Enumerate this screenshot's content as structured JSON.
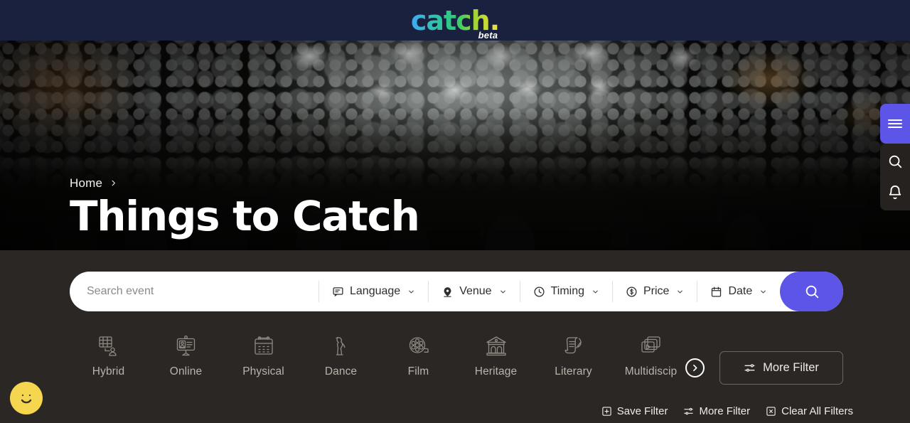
{
  "header": {
    "logo_text": "catch.",
    "logo_badge": "beta",
    "logo_gradient_from": "#3fa9f5",
    "logo_gradient_to": "#f2e33a",
    "bg": "#19213f"
  },
  "hero": {
    "breadcrumb": [
      {
        "label": "Home",
        "name": "breadcrumb-home"
      }
    ],
    "breadcrumb_separator_icon": "chevron-right-icon",
    "title": "Things to Catch"
  },
  "rail": {
    "menu_icon": "hamburger-menu-icon",
    "items": [
      {
        "icon": "search-icon",
        "name": "rail-search"
      },
      {
        "icon": "bell-icon",
        "name": "rail-notifications"
      }
    ],
    "accent": "#5d55e8"
  },
  "search": {
    "placeholder": "Search event",
    "value": "",
    "button_icon": "search-icon",
    "button_color": "#5d55e8",
    "filters": [
      {
        "label": "Language",
        "icon": "chat-bubble-icon",
        "name": "filter-language"
      },
      {
        "label": "Venue",
        "icon": "location-pin-icon",
        "name": "filter-venue"
      },
      {
        "label": "Timing",
        "icon": "clock-icon",
        "name": "filter-timing"
      },
      {
        "label": "Price",
        "icon": "dollar-circle-icon",
        "name": "filter-price"
      },
      {
        "label": "Date",
        "icon": "calendar-icon",
        "name": "filter-date"
      }
    ]
  },
  "categories": {
    "items": [
      {
        "label": "Hybrid",
        "icon": "hybrid-icon"
      },
      {
        "label": "Online",
        "icon": "online-icon"
      },
      {
        "label": "Physical",
        "icon": "physical-calendar-icon"
      },
      {
        "label": "Dance",
        "icon": "dance-icon"
      },
      {
        "label": "Film",
        "icon": "film-reel-icon"
      },
      {
        "label": "Heritage",
        "icon": "heritage-building-icon"
      },
      {
        "label": "Literary",
        "icon": "scroll-quill-icon"
      },
      {
        "label": "Multidiscip",
        "icon": "media-stack-icon"
      }
    ],
    "next_icon": "chevron-right-icon",
    "more_filter_label": "More Filter",
    "more_filter_icon": "tune-sliders-icon"
  },
  "bottom_actions": [
    {
      "label": "Save Filter",
      "icon": "square-plus-icon",
      "name": "save-filter"
    },
    {
      "label": "More Filter",
      "icon": "tune-sliders-icon",
      "name": "more-filter"
    },
    {
      "label": "Clear All Filters",
      "icon": "square-x-icon",
      "name": "clear-all-filters"
    }
  ],
  "feedback": {
    "icon": "smiley-face-icon",
    "color": "#f5d64e"
  }
}
